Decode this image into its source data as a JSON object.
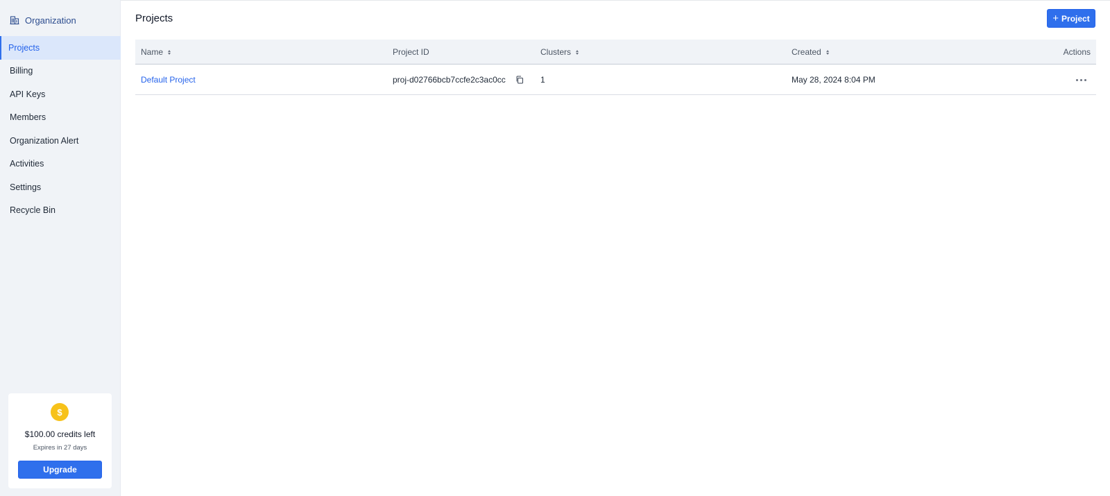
{
  "sidebar": {
    "org_label": "Organization",
    "items": [
      {
        "label": "Projects",
        "active": true
      },
      {
        "label": "Billing"
      },
      {
        "label": "API Keys"
      },
      {
        "label": "Members"
      },
      {
        "label": "Organization Alert"
      },
      {
        "label": "Activities"
      },
      {
        "label": "Settings"
      },
      {
        "label": "Recycle Bin"
      }
    ],
    "credits": {
      "coin_symbol": "$",
      "amount_text": "$100.00 credits left",
      "expires_text": "Expires in 27 days",
      "upgrade_label": "Upgrade"
    }
  },
  "main": {
    "title": "Projects",
    "add_button_label": "Project",
    "table": {
      "headers": {
        "name": "Name",
        "project_id": "Project ID",
        "clusters": "Clusters",
        "created": "Created",
        "actions": "Actions"
      },
      "rows": [
        {
          "name": "Default Project",
          "project_id": "proj-d02766bcb7ccfe2c3ac0cc",
          "clusters": "1",
          "created": "May 28, 2024 8:04 PM"
        }
      ]
    }
  },
  "colors": {
    "accent": "#2f6fec",
    "sidebar_bg": "#f0f3f7",
    "active_bg": "#dbe7fb",
    "coin": "#f7c21a"
  }
}
